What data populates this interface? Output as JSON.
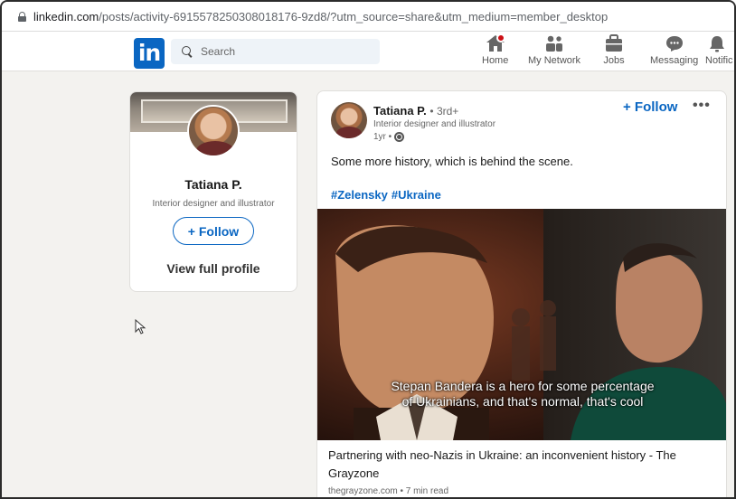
{
  "browser": {
    "url_host": "linkedin.com",
    "url_path": "/posts/activity-6915578250308018176-9zd8/?utm_source=share&utm_medium=member_desktop"
  },
  "nav": {
    "logo": "in",
    "search_placeholder": "Search",
    "items": [
      {
        "label": "Home",
        "icon": "home-icon"
      },
      {
        "label": "My Network",
        "icon": "network-icon"
      },
      {
        "label": "Jobs",
        "icon": "jobs-icon"
      },
      {
        "label": "Messaging",
        "icon": "messaging-icon"
      },
      {
        "label": "Notific",
        "icon": "notifications-icon"
      }
    ]
  },
  "profile_card": {
    "name": "Tatiana P.",
    "headline": "Interior designer and illustrator",
    "follow_label": "+ Follow",
    "view_profile_label": "View full profile"
  },
  "post": {
    "author": "Tatiana P.",
    "degree": "• 3rd+",
    "headline": "Interior designer and illustrator",
    "time": "1yr •",
    "follow_label": "+ Follow",
    "more_label": "•••",
    "text": "Some more history, which is behind the scene.",
    "hashtags": [
      "#Zelensky",
      "#Ukraine"
    ],
    "video_subtitle_line1": "Stepan Bandera is a hero for some percentage",
    "video_subtitle_line2": "of Ukrainians, and that's normal, that's cool",
    "link_title": "Partnering with neo-Nazis in Ukraine: an inconvenient history - The Grayzone",
    "link_meta": "thegrayzone.com • 7 min read"
  },
  "colors": {
    "brand": "#0a66c2",
    "page_bg": "#f3f2ef",
    "badge": "#cc1016"
  }
}
